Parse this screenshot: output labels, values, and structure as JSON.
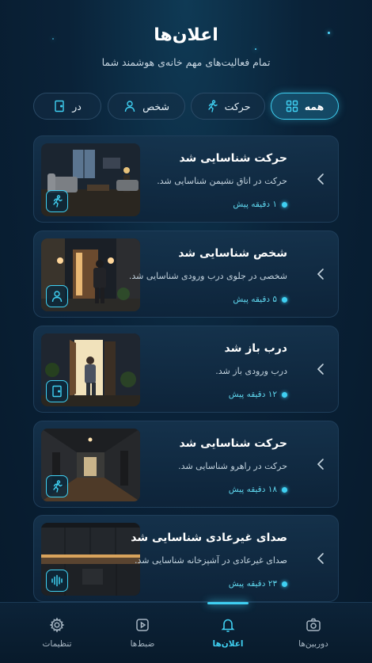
{
  "header": {
    "title": "اعلان‌ها",
    "subtitle": "تمام فعالیت‌های مهم خانه‌ی هوشمند شما"
  },
  "filters": [
    {
      "label": "همه",
      "icon": "grid-icon",
      "active": true
    },
    {
      "label": "حرکت",
      "icon": "running-person-icon",
      "active": false
    },
    {
      "label": "شخص",
      "icon": "person-icon",
      "active": false
    },
    {
      "label": "در",
      "icon": "door-icon",
      "active": false
    }
  ],
  "notifications": [
    {
      "title": "حرکت شناسایی شد",
      "description": "حرکت در اتاق نشیمن شناسایی شد.",
      "time": "۱ دقیقه پیش",
      "badge_icon": "running-person-icon",
      "scene": "living-room"
    },
    {
      "title": "شخص شناسایی شد",
      "description": "شخصی در جلوی درب ورودی شناسایی شد.",
      "time": "۵ دقیقه پیش",
      "badge_icon": "person-icon",
      "scene": "front-door-person"
    },
    {
      "title": "درب باز شد",
      "description": "درب ورودی باز شد.",
      "time": "۱۲ دقیقه پیش",
      "badge_icon": "door-icon",
      "scene": "door-open"
    },
    {
      "title": "حرکت شناسایی شد",
      "description": "حرکت در راهرو شناسایی شد.",
      "time": "۱۸ دقیقه پیش",
      "badge_icon": "running-person-icon",
      "scene": "hallway"
    },
    {
      "title": "صدای غیرعادی شناسایی شد",
      "description": "صدای غیرعادی در آشپزخانه شناسایی شد.",
      "time": "۲۳ دقیقه پیش",
      "badge_icon": "sound-wave-icon",
      "scene": "kitchen"
    }
  ],
  "nav": [
    {
      "label": "دوربین‌ها",
      "icon": "camera-icon",
      "active": false
    },
    {
      "label": "اعلان‌ها",
      "icon": "bell-icon",
      "active": true
    },
    {
      "label": "ضبط‌ها",
      "icon": "play-icon",
      "active": false
    },
    {
      "label": "تنظیمات",
      "icon": "gear-icon",
      "active": false
    }
  ],
  "colors": {
    "accent": "#3fd0f2",
    "background": "#0a2238",
    "card": "#14304a"
  }
}
